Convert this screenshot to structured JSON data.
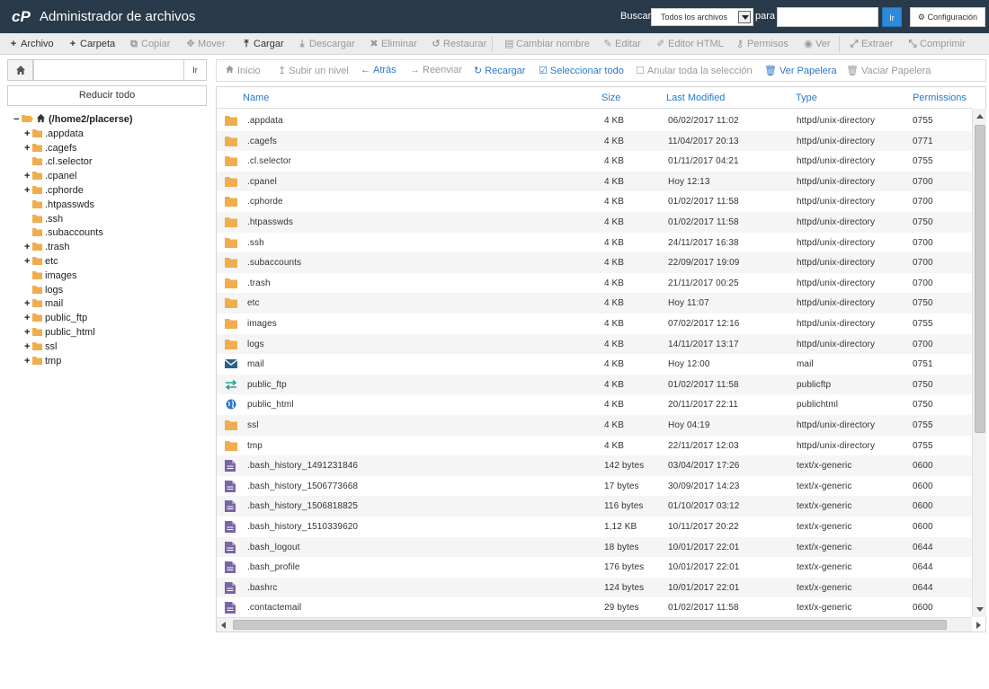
{
  "header": {
    "title": "Administrador de archivos",
    "search_label": "Buscar",
    "search_scope": "Todos los archivos",
    "for_label": "para",
    "search_value": "",
    "go_label": "Ir",
    "settings_label": "Configuración"
  },
  "toolbar": [
    {
      "label": "Archivo",
      "icon": "plus-icon",
      "enabled": true
    },
    {
      "label": "Carpeta",
      "icon": "plus-icon",
      "enabled": true
    },
    {
      "label": "Copiar",
      "icon": "copy-icon",
      "enabled": false
    },
    {
      "label": "Mover",
      "icon": "move-icon",
      "enabled": false
    },
    {
      "label": "Cargar",
      "icon": "upload-icon",
      "enabled": true
    },
    {
      "label": "Descargar",
      "icon": "download-icon",
      "enabled": false
    },
    {
      "label": "Eliminar",
      "icon": "delete-icon",
      "enabled": false
    },
    {
      "label": "Restaurar",
      "icon": "restore-icon",
      "enabled": false
    },
    {
      "label": "Cambiar nombre",
      "icon": "rename-icon",
      "enabled": false
    },
    {
      "label": "Editar",
      "icon": "pencil-icon",
      "enabled": false
    },
    {
      "label": "Editor HTML",
      "icon": "html-editor-icon",
      "enabled": false
    },
    {
      "label": "Permisos",
      "icon": "key-icon",
      "enabled": false
    },
    {
      "label": "Ver",
      "icon": "eye-icon",
      "enabled": false
    },
    {
      "label": "Extraer",
      "icon": "extract-icon",
      "enabled": false
    },
    {
      "label": "Comprimir",
      "icon": "compress-icon",
      "enabled": false
    }
  ],
  "left": {
    "path_value": "",
    "go_label": "Ir",
    "collapse_label": "Reducir todo",
    "root_label": "(/home2/placerse)",
    "tree": [
      {
        "label": ".appdata",
        "expandable": true
      },
      {
        "label": ".cagefs",
        "expandable": true
      },
      {
        "label": ".cl.selector",
        "expandable": false
      },
      {
        "label": ".cpanel",
        "expandable": true
      },
      {
        "label": ".cphorde",
        "expandable": true
      },
      {
        "label": ".htpasswds",
        "expandable": false
      },
      {
        "label": ".ssh",
        "expandable": false
      },
      {
        "label": ".subaccounts",
        "expandable": false
      },
      {
        "label": ".trash",
        "expandable": true
      },
      {
        "label": "etc",
        "expandable": true
      },
      {
        "label": "images",
        "expandable": false
      },
      {
        "label": "logs",
        "expandable": false
      },
      {
        "label": "mail",
        "expandable": true
      },
      {
        "label": "public_ftp",
        "expandable": true
      },
      {
        "label": "public_html",
        "expandable": true
      },
      {
        "label": "ssl",
        "expandable": true
      },
      {
        "label": "tmp",
        "expandable": true
      }
    ]
  },
  "nav": [
    {
      "label": "Inicio",
      "icon": "home-icon",
      "enabled": false
    },
    {
      "label": "Subir un nivel",
      "icon": "level-up-icon",
      "enabled": false
    },
    {
      "label": "Atrás",
      "icon": "arrow-left-icon",
      "enabled": true
    },
    {
      "label": "Reenviar",
      "icon": "arrow-right-icon",
      "enabled": false
    },
    {
      "label": "Recargar",
      "icon": "reload-icon",
      "enabled": true
    },
    {
      "label": "Seleccionar todo",
      "icon": "check-square-icon",
      "enabled": true
    },
    {
      "label": "Anular toda la selección",
      "icon": "square-icon",
      "enabled": false
    },
    {
      "label": "Ver Papelera",
      "icon": "trash-icon",
      "enabled": true
    },
    {
      "label": "Vaciar Papelera",
      "icon": "trash-icon",
      "enabled": false
    }
  ],
  "table": {
    "columns": [
      "Name",
      "Size",
      "Last Modified",
      "Type",
      "Permissions"
    ],
    "rows": [
      {
        "name": ".appdata",
        "size": "4 KB",
        "modified": "06/02/2017 11:02",
        "type": "httpd/unix-directory",
        "perms": "0755",
        "icon": "folder-icon"
      },
      {
        "name": ".cagefs",
        "size": "4 KB",
        "modified": "11/04/2017 20:13",
        "type": "httpd/unix-directory",
        "perms": "0771",
        "icon": "folder-icon"
      },
      {
        "name": ".cl.selector",
        "size": "4 KB",
        "modified": "01/11/2017 04:21",
        "type": "httpd/unix-directory",
        "perms": "0755",
        "icon": "folder-icon"
      },
      {
        "name": ".cpanel",
        "size": "4 KB",
        "modified": "Hoy 12:13",
        "type": "httpd/unix-directory",
        "perms": "0700",
        "icon": "folder-icon"
      },
      {
        "name": ".cphorde",
        "size": "4 KB",
        "modified": "01/02/2017 11:58",
        "type": "httpd/unix-directory",
        "perms": "0700",
        "icon": "folder-icon"
      },
      {
        "name": ".htpasswds",
        "size": "4 KB",
        "modified": "01/02/2017 11:58",
        "type": "httpd/unix-directory",
        "perms": "0750",
        "icon": "folder-icon"
      },
      {
        "name": ".ssh",
        "size": "4 KB",
        "modified": "24/11/2017 16:38",
        "type": "httpd/unix-directory",
        "perms": "0700",
        "icon": "folder-icon"
      },
      {
        "name": ".subaccounts",
        "size": "4 KB",
        "modified": "22/09/2017 19:09",
        "type": "httpd/unix-directory",
        "perms": "0700",
        "icon": "folder-icon"
      },
      {
        "name": ".trash",
        "size": "4 KB",
        "modified": "21/11/2017 00:25",
        "type": "httpd/unix-directory",
        "perms": "0700",
        "icon": "folder-icon"
      },
      {
        "name": "etc",
        "size": "4 KB",
        "modified": "Hoy 11:07",
        "type": "httpd/unix-directory",
        "perms": "0750",
        "icon": "folder-icon"
      },
      {
        "name": "images",
        "size": "4 KB",
        "modified": "07/02/2017 12:16",
        "type": "httpd/unix-directory",
        "perms": "0755",
        "icon": "folder-icon"
      },
      {
        "name": "logs",
        "size": "4 KB",
        "modified": "14/11/2017 13:17",
        "type": "httpd/unix-directory",
        "perms": "0700",
        "icon": "folder-icon"
      },
      {
        "name": "mail",
        "size": "4 KB",
        "modified": "Hoy 12:00",
        "type": "mail",
        "perms": "0751",
        "icon": "mail-icon"
      },
      {
        "name": "public_ftp",
        "size": "4 KB",
        "modified": "01/02/2017 11:58",
        "type": "publicftp",
        "perms": "0750",
        "icon": "exchange-icon"
      },
      {
        "name": "public_html",
        "size": "4 KB",
        "modified": "20/11/2017 22:11",
        "type": "publichtml",
        "perms": "0750",
        "icon": "globe-icon"
      },
      {
        "name": "ssl",
        "size": "4 KB",
        "modified": "Hoy 04:19",
        "type": "httpd/unix-directory",
        "perms": "0755",
        "icon": "folder-icon"
      },
      {
        "name": "tmp",
        "size": "4 KB",
        "modified": "22/11/2017 12:03",
        "type": "httpd/unix-directory",
        "perms": "0755",
        "icon": "folder-icon"
      },
      {
        "name": ".bash_history_1491231846",
        "size": "142 bytes",
        "modified": "03/04/2017 17:26",
        "type": "text/x-generic",
        "perms": "0600",
        "icon": "file-icon"
      },
      {
        "name": ".bash_history_1506773668",
        "size": "17 bytes",
        "modified": "30/09/2017 14:23",
        "type": "text/x-generic",
        "perms": "0600",
        "icon": "file-icon"
      },
      {
        "name": ".bash_history_1506818825",
        "size": "116 bytes",
        "modified": "01/10/2017 03:12",
        "type": "text/x-generic",
        "perms": "0600",
        "icon": "file-icon"
      },
      {
        "name": ".bash_history_1510339620",
        "size": "1,12 KB",
        "modified": "10/11/2017 20:22",
        "type": "text/x-generic",
        "perms": "0600",
        "icon": "file-icon"
      },
      {
        "name": ".bash_logout",
        "size": "18 bytes",
        "modified": "10/01/2017 22:01",
        "type": "text/x-generic",
        "perms": "0644",
        "icon": "file-icon"
      },
      {
        "name": ".bash_profile",
        "size": "176 bytes",
        "modified": "10/01/2017 22:01",
        "type": "text/x-generic",
        "perms": "0644",
        "icon": "file-icon"
      },
      {
        "name": ".bashrc",
        "size": "124 bytes",
        "modified": "10/01/2017 22:01",
        "type": "text/x-generic",
        "perms": "0644",
        "icon": "file-icon"
      },
      {
        "name": ".contactemail",
        "size": "29 bytes",
        "modified": "01/02/2017 11:58",
        "type": "text/x-generic",
        "perms": "0600",
        "icon": "file-icon"
      }
    ]
  },
  "colors": {
    "header_bg": "#293a4a",
    "link": "#2a79c8",
    "folder": "#f0ad4e",
    "file": "#7a64a6",
    "button_primary": "#2c8ad8"
  }
}
